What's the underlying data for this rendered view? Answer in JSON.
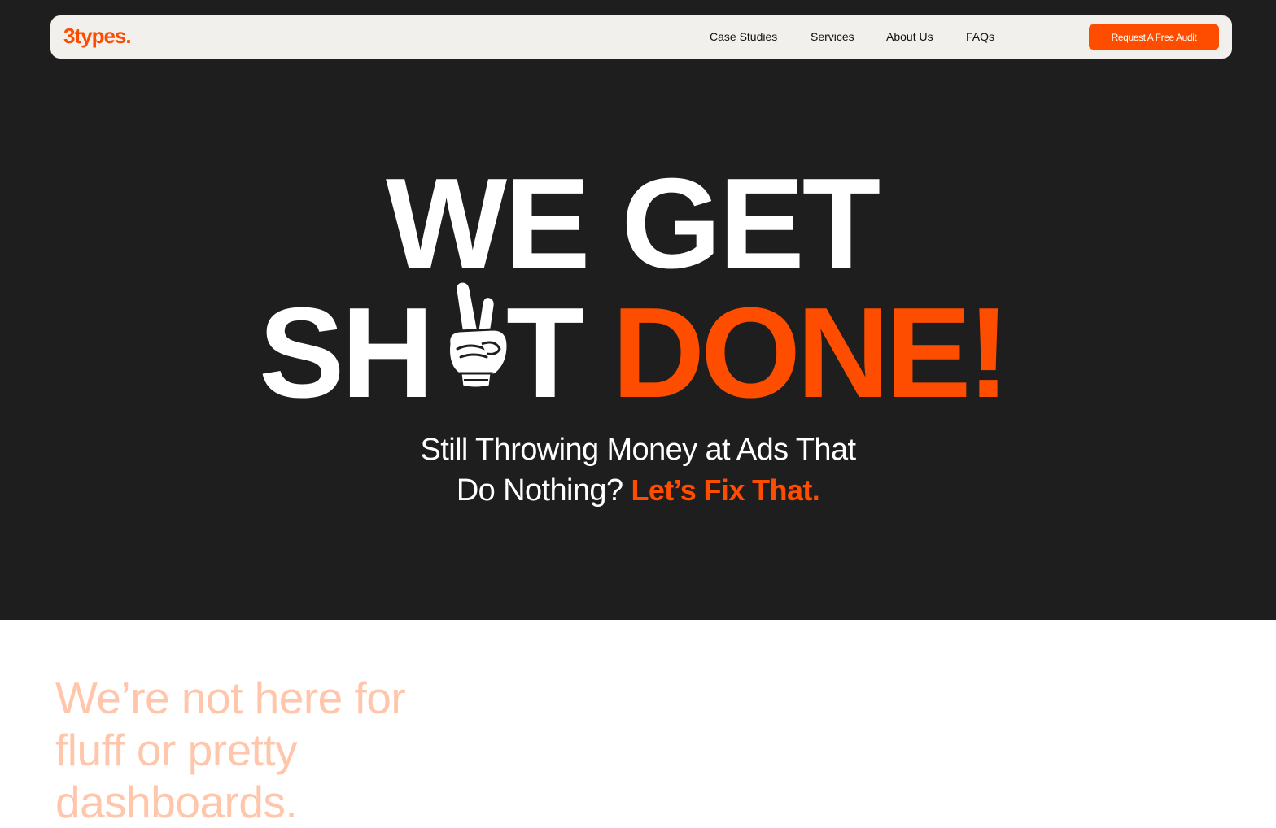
{
  "colors": {
    "accent": "#ff4d00",
    "hero_bg": "#1e1e1e",
    "nav_bg": "#f2f0ec",
    "section_heading": "#ffc6ab"
  },
  "nav": {
    "logo": "3types.",
    "links": [
      "Case Studies",
      "Services",
      "About Us",
      "FAQs"
    ],
    "cta": "Request A Free Audit"
  },
  "hero": {
    "line1": "WE GET",
    "line2_start": "SH",
    "line2_icon": "peace-sign-hand-icon",
    "line2_end": "T",
    "line2_accent": "DONE!",
    "subhead_line1": "Still Throwing Money at Ads That",
    "subhead_line2": "Do Nothing?",
    "subhead_accent": "Let’s Fix That."
  },
  "section": {
    "heading_line1": "We’re not here for",
    "heading_line2": "fluff or pretty",
    "heading_line3": "dashboards."
  }
}
